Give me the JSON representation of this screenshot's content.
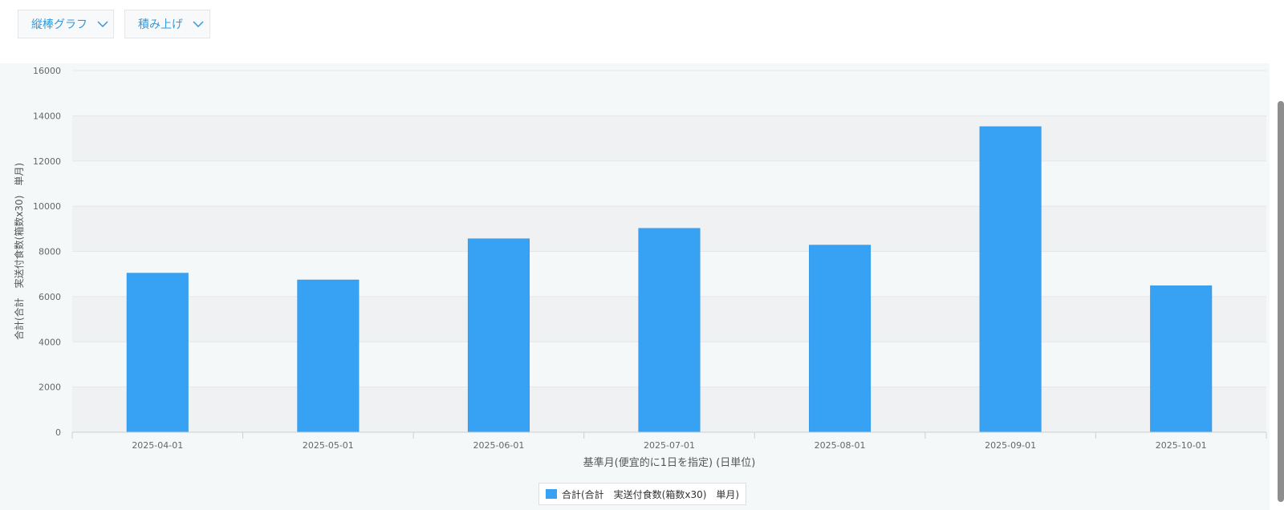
{
  "toolbar": {
    "chart_type_label": "縦棒グラフ",
    "stack_label": "積み上げ"
  },
  "icons": {
    "dropdown": "chevron-down-icon"
  },
  "colors": {
    "bar": "#37a2f4",
    "accent": "#3498db"
  },
  "chart_data": {
    "type": "bar",
    "categories": [
      "2025-04-01",
      "2025-05-01",
      "2025-06-01",
      "2025-07-01",
      "2025-08-01",
      "2025-09-01",
      "2025-10-01"
    ],
    "series": [
      {
        "name": "合計(合計　実送付食数(箱数x30)　単月)",
        "values": [
          7040,
          6740,
          8560,
          9020,
          8280,
          13520,
          6480
        ]
      }
    ],
    "xlabel": "基準月(便宜的に1日を指定) (日単位)",
    "ylabel": "合計(合計　実送付食数(箱数x30)　単月)",
    "ylim": [
      0,
      16000
    ],
    "yticks": [
      0,
      2000,
      4000,
      6000,
      8000,
      10000,
      12000,
      14000,
      16000
    ],
    "grid": true,
    "legend_position": "bottom"
  }
}
